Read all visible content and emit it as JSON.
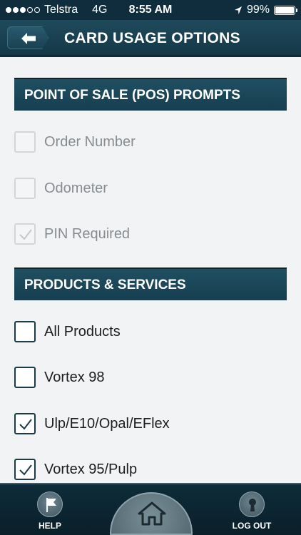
{
  "status_bar": {
    "carrier": "Telstra",
    "network": "4G",
    "time": "8:55 AM",
    "battery": "99%",
    "battery_level": 0.99,
    "signal_bars": 3
  },
  "header": {
    "title": "CARD USAGE OPTIONS",
    "back_icon": "back-arrow-icon"
  },
  "pos_section": {
    "title": "POINT OF SALE (POS) PROMPTS",
    "items": [
      {
        "label": "Order Number",
        "checked": false
      },
      {
        "label": "Odometer",
        "checked": false
      },
      {
        "label": "PIN Required",
        "checked": true
      }
    ]
  },
  "products_section": {
    "title": "PRODUCTS & SERVICES",
    "items": [
      {
        "label": "All Products",
        "checked": false
      },
      {
        "label": "Vortex 98",
        "checked": false
      },
      {
        "label": "Ulp/E10/Opal/EFlex",
        "checked": true
      },
      {
        "label": "Vortex 95/Pulp",
        "checked": true
      }
    ]
  },
  "bottom_nav": {
    "help": "HELP",
    "logout": "LOG OUT",
    "home_icon": "home-icon"
  }
}
